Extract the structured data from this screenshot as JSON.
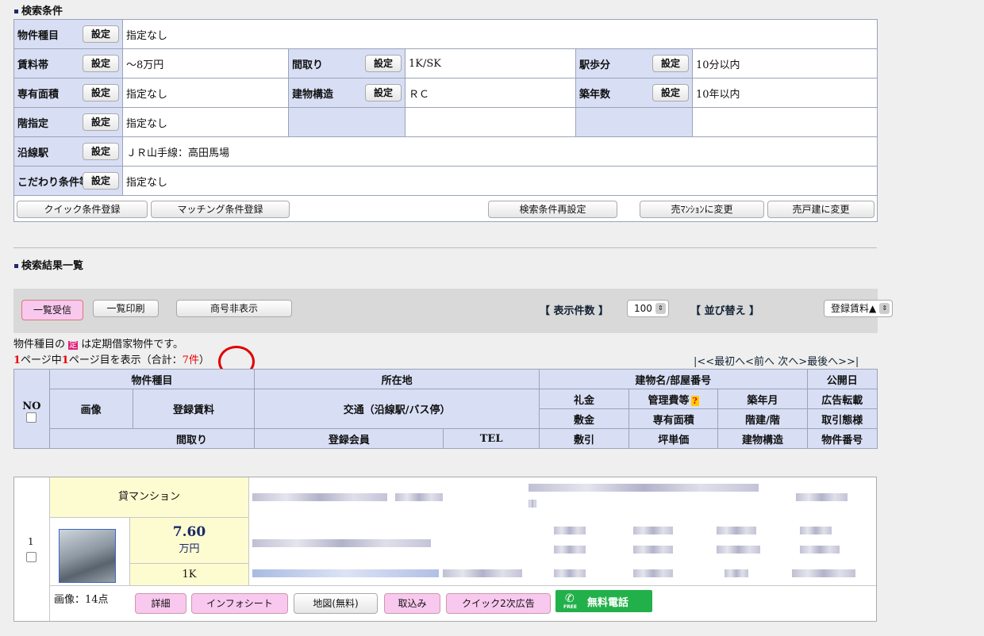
{
  "cond_title": "検索条件",
  "cond": {
    "r1": {
      "label": "物件種目",
      "value": "指定なし"
    },
    "r2": [
      {
        "label": "賃料帯",
        "value": "〜8万円"
      },
      {
        "label": "間取り",
        "value": "1K/SK"
      },
      {
        "label": "駅歩分",
        "value": "10分以内"
      }
    ],
    "r3": [
      {
        "label": "専有面積",
        "value": "指定なし"
      },
      {
        "label": "建物構造",
        "value": "ＲＣ"
      },
      {
        "label": "築年数",
        "value": "10年以内"
      }
    ],
    "r4": {
      "label": "階指定",
      "value": "指定なし"
    },
    "r5": {
      "label": "沿線駅",
      "value": "ＪＲ山手線：高田馬場"
    },
    "r6": {
      "label": "こだわり条件等",
      "value": "指定なし"
    },
    "set_label": "設定"
  },
  "cond_buttons": {
    "quick": "クイック条件登録",
    "matching": "マッチング条件登録",
    "reset": "検索条件再設定",
    "mansion": "売ﾏﾝｼｮﾝに変更",
    "house": "売戸建に変更"
  },
  "result_title": "検索結果一覧",
  "toolbar": {
    "receive": "一覧受信",
    "print": "一覧印刷",
    "hide": "商号非表示",
    "count_label": "【 表示件数 】",
    "count_value": "100",
    "sort_label": "【 並び替え 】",
    "sort_value": "登録賃料▲"
  },
  "notice": {
    "pre": "物件種目の",
    "badge": "定",
    "post": "は定期借家物件です。"
  },
  "paging": {
    "p1": "1",
    "t1": "ページ中",
    "p2": "1",
    "t2": "ページ目を表示（合計：",
    "total": "7件",
    "t3": "）",
    "nav": "|<<最初へ<前へ 次へ>最後へ>>|"
  },
  "header": {
    "no": "NO",
    "kind": "物件種目",
    "location": "所在地",
    "building": "建物名/部屋番号",
    "published": "公開日",
    "image": "画像",
    "rent": "登録賃料",
    "access": "交通（沿線駅/バス停）",
    "reikin": "礼金",
    "kanri": "管理費等",
    "chiku": "築年月",
    "koukoku": "広告転載",
    "shikikin": "敷金",
    "menseki": "専有面積",
    "kai": "階建/階",
    "torihiki": "取引態様",
    "madori": "間取り",
    "member": "登録会員",
    "tel": "TEL",
    "shikibiki": "敷引",
    "tsubo": "坪単価",
    "kouzou": "建物構造",
    "bukken_no": "物件番号",
    "help": "?"
  },
  "row": {
    "no": "1",
    "kind": "貸マンション",
    "rent": "7.60",
    "unit": "万円",
    "layout": "1K",
    "images": "画像：14点"
  },
  "row_buttons": {
    "detail": "詳細",
    "info": "インフォシート",
    "map": "地図(無料)",
    "take": "取込み",
    "quick2": "クイック2次広告",
    "call": "無料電話",
    "free": "FREE"
  },
  "colors": {
    "header_bg": "#d8dff5",
    "pink": "#f9c8ee",
    "yellow": "#fdfbd0",
    "green": "#22b04a",
    "red": "#e00000"
  }
}
